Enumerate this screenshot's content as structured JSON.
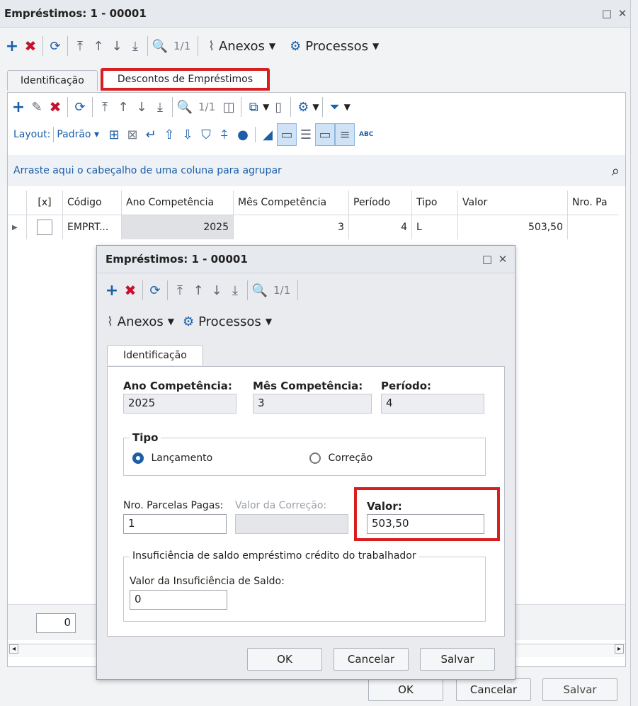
{
  "outer": {
    "title": "Empréstimos: 1 - 00001",
    "pager": "1/1",
    "menu_anexos": "Anexos",
    "menu_processos": "Processos",
    "tabs": [
      {
        "label": "Identificação"
      },
      {
        "label": "Descontos de Empréstimos"
      }
    ]
  },
  "grid": {
    "pager": "1/1",
    "layout_label": "Layout:",
    "layout_value": "Padrão",
    "abc_label": "ABC",
    "group_hint": "Arraste aqui o cabeçalho de uma coluna para agrupar",
    "columns": [
      "[x]",
      "Código",
      "Ano Competência",
      "Mês Competência",
      "Período",
      "Tipo",
      "Valor",
      "Nro. Pa"
    ],
    "row": {
      "codigo": "EMPRT...",
      "ano": "2025",
      "mes": "3",
      "periodo": "4",
      "tipo": "L",
      "valor": "503,50"
    },
    "footer_value": "0"
  },
  "dialog": {
    "title": "Empréstimos: 1 - 00001",
    "pager": "1/1",
    "menu_anexos": "Anexos",
    "menu_processos": "Processos",
    "tab": "Identificação",
    "ano_label": "Ano Competência:",
    "ano_value": "2025",
    "mes_label": "Mês Competência:",
    "mes_value": "3",
    "periodo_label": "Período:",
    "periodo_value": "4",
    "tipo_legend": "Tipo",
    "radio_lancamento": "Lançamento",
    "radio_correcao": "Correção",
    "parcelas_label": "Nro. Parcelas Pagas:",
    "parcelas_value": "1",
    "correcao_label": "Valor da Correção:",
    "valor_label": "Valor:",
    "valor_value": "503,50",
    "insuf_legend": "Insuficiência de saldo empréstimo crédito do trabalhador",
    "insuf_label": "Valor da Insuficiência de Saldo:",
    "insuf_value": "0",
    "ok": "OK",
    "cancel": "Cancelar",
    "save": "Salvar"
  },
  "footer": {
    "ok": "OK",
    "cancel": "Cancelar",
    "save": "Salvar"
  },
  "colors": {
    "accent": "#1a5fa8",
    "delete": "#c8102e",
    "highlight": "#d81e1e"
  }
}
